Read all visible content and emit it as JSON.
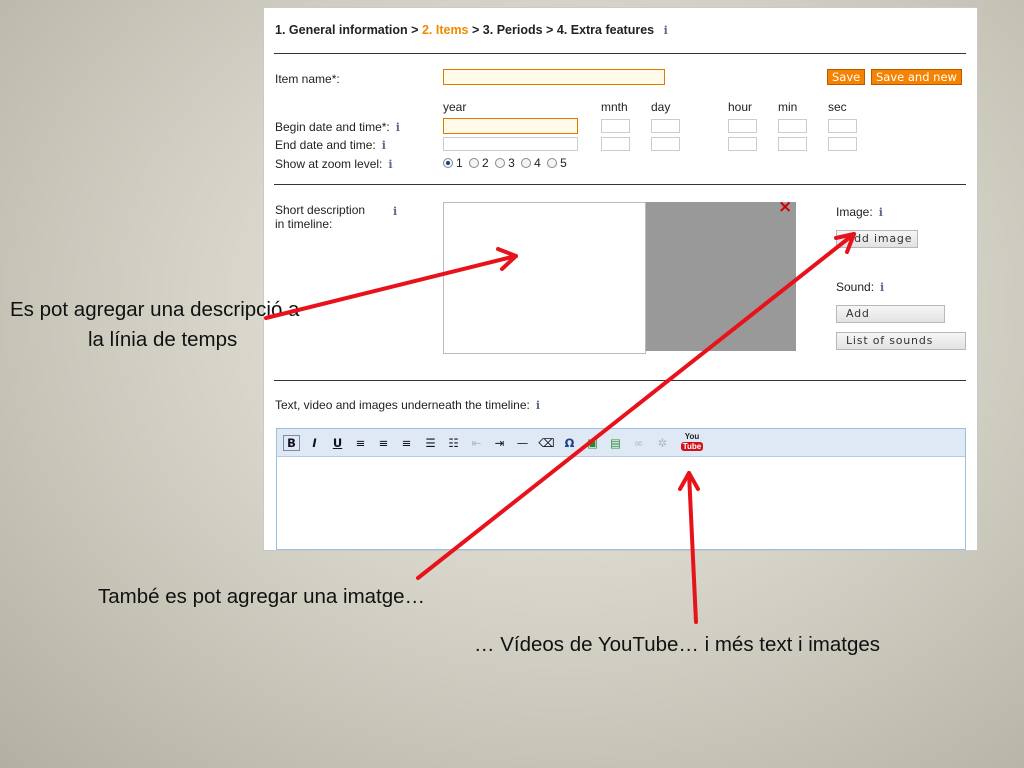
{
  "breadcrumb": {
    "step1": "1. General information",
    "sep1": ">",
    "step2": "2. Items",
    "sep2": ">",
    "step3": "3. Periods",
    "sep3": ">",
    "step4": "4. Extra features",
    "info": "i"
  },
  "form": {
    "item_name_label": "Item name*:",
    "save_label": "Save",
    "save_new_label": "Save and new",
    "columns": [
      "year",
      "mnth",
      "day",
      "hour",
      "min",
      "sec"
    ],
    "begin_label": "Begin date and time*:",
    "end_label": "End date and time:",
    "zoom_label": "Show at zoom level:",
    "zoom_options": [
      "1",
      "2",
      "3",
      "4",
      "5"
    ],
    "zoom_selected": "1",
    "short_desc_line1": "Short description",
    "short_desc_line2": "in timeline:",
    "close_mark": "×",
    "image_label": "Image:",
    "add_image_label": "Add image",
    "sound_label": "Sound:",
    "add_label": "Add",
    "list_sounds_label": "List of sounds",
    "text_label": "Text, video and images underneath the timeline:",
    "info": "i"
  },
  "toolbar": {
    "bold": "B",
    "italic": "I",
    "underline": "U",
    "youtube_you": "You",
    "youtube_tube": "Tube"
  },
  "annotations": {
    "desc_line1": "Es pot agregar una descripció a",
    "desc_line2": "la línia de temps",
    "image": "També es pot agregar una imatge…",
    "youtube": "… Vídeos de YouTube… i més text i imatges"
  },
  "colors": {
    "accent_orange": "#f58200",
    "arrow_red": "#e8121a",
    "toolbar_blue": "#dfe9f5"
  }
}
